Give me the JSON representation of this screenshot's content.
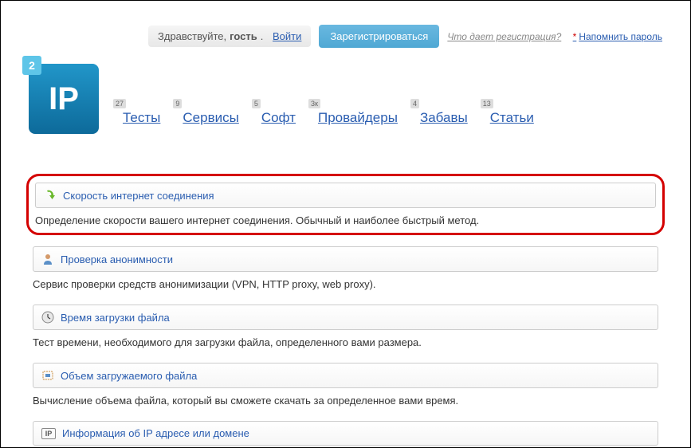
{
  "header": {
    "greeting_prefix": "Здравствуйте,",
    "greeting_guest": "гость",
    "greeting_dot": ".",
    "login": "Войти",
    "register": "Зарегистрироваться",
    "reg_info": "Что дает регистрация?",
    "remind": "Напомнить пароль"
  },
  "logo": {
    "text": "IP",
    "badge": "2"
  },
  "nav": [
    {
      "label": "Тесты",
      "count": "27"
    },
    {
      "label": "Сервисы",
      "count": "9"
    },
    {
      "label": "Софт",
      "count": "5"
    },
    {
      "label": "Провайдеры",
      "count": "3к"
    },
    {
      "label": "Забавы",
      "count": "4"
    },
    {
      "label": "Статьи",
      "count": "13"
    }
  ],
  "items": [
    {
      "title": "Скорость интернет соединения",
      "desc": "Определение скорости вашего интернет соединения. Обычный и наиболее быстрый метод."
    },
    {
      "title": "Проверка анонимности",
      "desc": "Сервис проверки средств анонимизации (VPN, HTTP proxy, web proxy)."
    },
    {
      "title": "Время загрузки файла",
      "desc": "Тест времени, необходимого для загрузки файла, определенного вами размера."
    },
    {
      "title": "Объем загружаемого файла",
      "desc": "Вычисление объема файла, который вы сможете скачать за определенное вами время."
    },
    {
      "title": "Информация об IP адресе или домене",
      "desc": ""
    }
  ],
  "ip_icon_text": "IP"
}
